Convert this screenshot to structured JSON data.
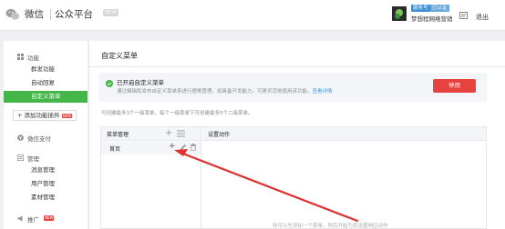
{
  "header": {
    "brand": "微信",
    "brand_sub": "公众平台",
    "beta_badge": "BETA",
    "badge_verified": "服务号",
    "badge_verified2": "已认证",
    "account_name": "梦想程网络营销",
    "logout": "退出"
  },
  "sidebar": {
    "groups": [
      {
        "title": "功能",
        "icon": "function-icon",
        "items": [
          "群发功能",
          "自动回复",
          "自定义菜单"
        ]
      },
      {
        "title": "微信支付",
        "icon": "payment-icon",
        "items": []
      },
      {
        "title": "管理",
        "icon": "manage-icon",
        "items": [
          "消息管理",
          "用户管理",
          "素材管理"
        ]
      },
      {
        "title": "推广",
        "icon": "promote-icon",
        "items": []
      }
    ],
    "active_item": "自定义菜单",
    "add_plugin": "+ 添加功能插件",
    "new_badge": "NEW"
  },
  "main": {
    "title": "自定义菜单",
    "notice_title": "已开启自定义菜单",
    "notice_desc": "通过编辑和发布自定义菜单来进行便携管理，如具备开发能力，可更灵活地使用该功能。",
    "notice_link": "查看详情",
    "disable_button": "停用",
    "hint": "可创建最多3个一级菜单，每个一级菜单下可创建最多5个二级菜单。",
    "menu_manage_title": "菜单管理",
    "action_title": "设置动作",
    "menu_items": [
      "首页"
    ],
    "empty_text": "你可以先添加一个菜单，然后开始为其设置响应动作"
  },
  "colors": {
    "accent": "#44b549",
    "danger": "#e64340",
    "link": "#459ae9",
    "arrow": "#e03030"
  }
}
